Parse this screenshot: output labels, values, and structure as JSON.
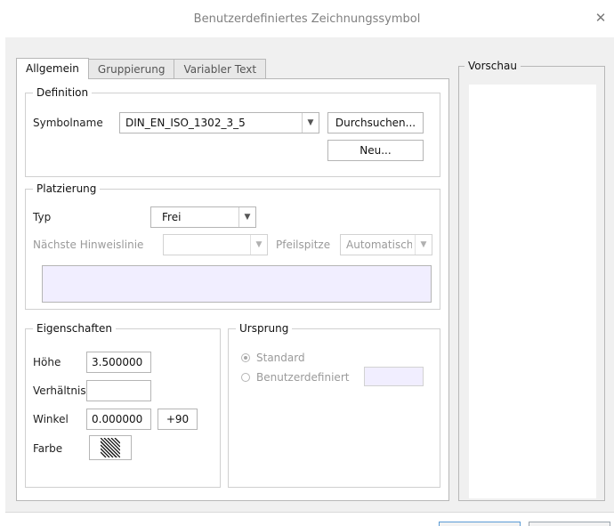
{
  "window": {
    "title": "Benutzerdefiniertes Zeichnungssymbol",
    "close_glyph": "✕"
  },
  "tabs": [
    {
      "label": "Allgemein",
      "active": true
    },
    {
      "label": "Gruppierung",
      "active": false
    },
    {
      "label": "Variabler Text",
      "active": false
    }
  ],
  "definition": {
    "legend": "Definition",
    "symbolname_label": "Symbolname",
    "symbolname_value": "DIN_EN_ISO_1302_3_5",
    "browse_button": "Durchsuchen...",
    "new_button": "Neu..."
  },
  "placement": {
    "legend": "Platzierung",
    "type_label": "Typ",
    "type_value": "Frei",
    "nearest_leader_label": "Nächste Hinweislinie",
    "nearest_leader_value": "",
    "arrowhead_label": "Pfeilspitze",
    "arrowhead_value": "Automatisch"
  },
  "properties": {
    "legend": "Eigenschaften",
    "height_label": "Höhe",
    "height_value": "3.500000",
    "ratio_label": "Verhältnis",
    "ratio_value": "",
    "angle_label": "Winkel",
    "angle_value": "0.000000",
    "rotate_button": "+90",
    "color_label": "Farbe",
    "color_icon": "hatch-swatch-icon"
  },
  "origin": {
    "legend": "Ursprung",
    "option_standard": "Standard",
    "option_custom": "Benutzerdefiniert",
    "selected": "Standard"
  },
  "preview": {
    "legend": "Vorschau"
  },
  "colors": {
    "dialog_bg": "#f0f0f0",
    "panel_bg": "#ffffff",
    "highlight_field": "#f1eeff",
    "disabled_text": "#9a9a9a"
  }
}
